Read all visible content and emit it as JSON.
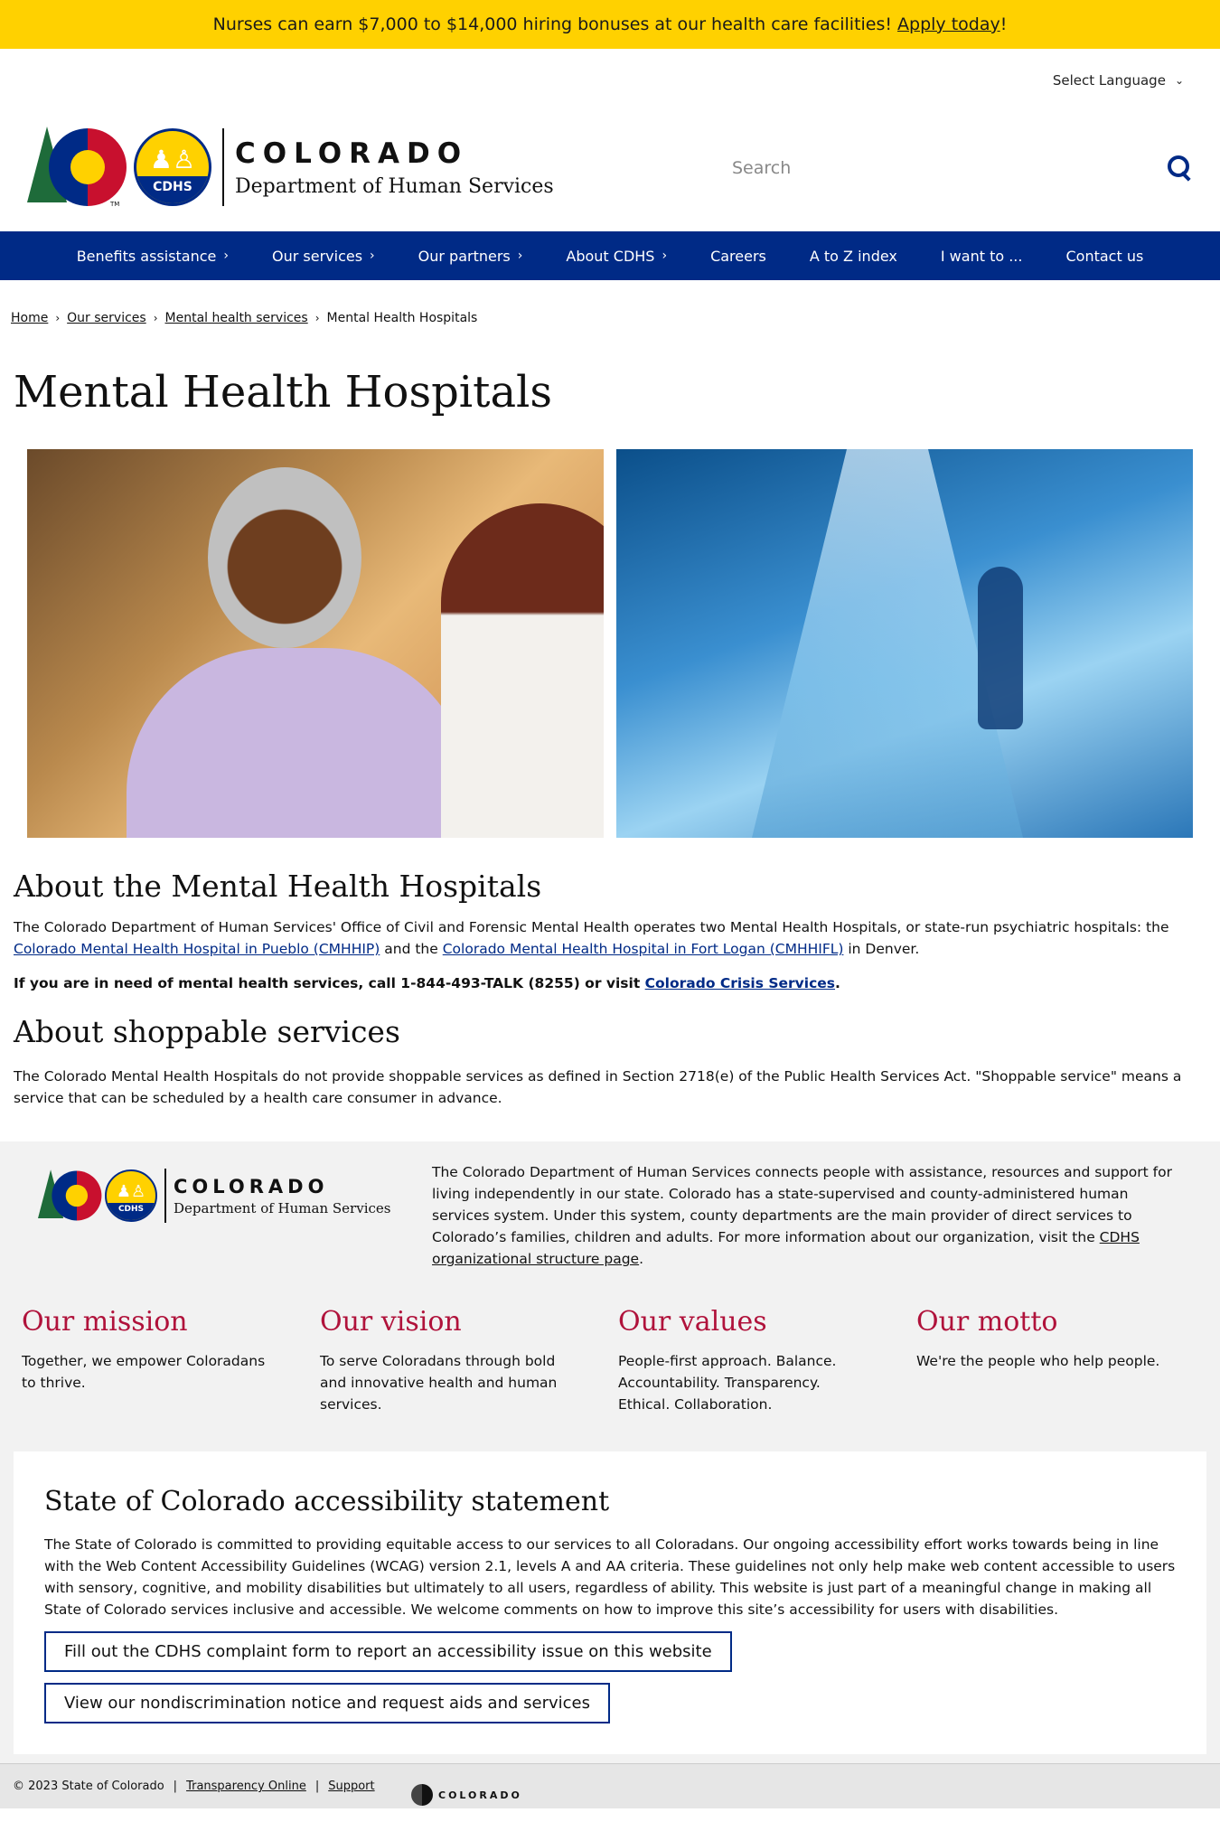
{
  "alert": {
    "text": "Nurses can earn $7,000 to $14,000 hiring bonuses at our health care facilities!",
    "link": "Apply today",
    "suffix": "!"
  },
  "language": {
    "label": "Select Language",
    "icon": "chevron-down-icon"
  },
  "brand": {
    "name": "COLORADO",
    "subtitle": "Department of Human Services",
    "badge": "CDHS",
    "tm": "TM"
  },
  "search": {
    "placeholder": "Search",
    "icon": "search-icon"
  },
  "nav": {
    "items": [
      {
        "label": "Benefits assistance",
        "caret": true
      },
      {
        "label": "Our services",
        "caret": true
      },
      {
        "label": "Our partners",
        "caret": true
      },
      {
        "label": "About CDHS",
        "caret": true
      },
      {
        "label": "Careers",
        "caret": false
      },
      {
        "label": "A to Z index",
        "caret": false
      },
      {
        "label": "I want to ...",
        "caret": false
      },
      {
        "label": "Contact us",
        "caret": false
      }
    ]
  },
  "breadcrumb": {
    "items": [
      "Home",
      "Our services",
      "Mental health services"
    ],
    "current": "Mental Health Hospitals"
  },
  "page_title": "Mental Health Hospitals",
  "about": {
    "heading": "About the Mental Health Hospitals",
    "p1_before": "The Colorado Department of Human Services' Office of Civil and Forensic Mental Health operates two Mental Health Hospitals, or state-run psychiatric hospitals: the",
    "p1_link1": "Colorado Mental Health Hospital in Pueblo (CMHHIP)",
    "p1_mid": "and the",
    "p1_link2": "Colorado Mental Health Hospital in Fort Logan (CMHHIFL)",
    "p1_after": "in Denver.",
    "p2_before": "If you are in need of mental health services, call 1-844-493-TALK (8255) or visit",
    "p2_link": "Colorado Crisis Services",
    "p2_after": "."
  },
  "shoppable": {
    "heading": "About shoppable services",
    "text": "The Colorado Mental Health Hospitals do not provide shoppable services as defined in Section 2718(e) of the Public Health Services Act. \"Shoppable service\" means a service that can be scheduled by a health care consumer in advance."
  },
  "footer": {
    "description": "The Colorado Department of Human Services connects people with assistance, resources and support for living independently in our state. Colorado has a state-supervised and county-administered human services system. Under this system, county departments are the main provider of direct services to Colorado’s families, children and adults. For more information about our organization, visit the",
    "description_link": "CDHS organizational structure page",
    "description_end": ".",
    "pillars": [
      {
        "title": "Our mission",
        "text": "Together, we empower Coloradans to thrive."
      },
      {
        "title": "Our vision",
        "text": "To serve Coloradans through bold and innovative health and human services."
      },
      {
        "title": "Our values",
        "text": "People-first approach. Balance. Accountability. Transparency. Ethical. Collaboration."
      },
      {
        "title": "Our motto",
        "text": "We're the people who help people."
      }
    ]
  },
  "accessibility": {
    "heading": "State of Colorado accessibility statement",
    "text": "The State of Colorado is committed to providing equitable access to our services to all Coloradans. Our ongoing accessibility effort works towards being in line with the Web Content Accessibility Guidelines (WCAG) version 2.1, levels A and AA criteria. These guidelines not only help make web content accessible to users with sensory, cognitive, and mobility disabilities but ultimately to all users, regardless of ability. This website is just part of a meaningful change in making all State of Colorado services inclusive and accessible. We welcome comments on how to improve this site’s accessibility for users with disabilities.",
    "button1": "Fill out the CDHS complaint form to report an accessibility issue on this website",
    "button2": "View our nondiscrimination notice and request aids and services"
  },
  "bottom_bar": {
    "copyright": "© 2023 State of Colorado",
    "link1": "Transparency Online",
    "link2": "Support",
    "logo_text": "COLORADO",
    "pipe": "|"
  },
  "colors": {
    "alert": "#ffd100",
    "nav": "#002a86",
    "accent_red": "#b0123b"
  }
}
